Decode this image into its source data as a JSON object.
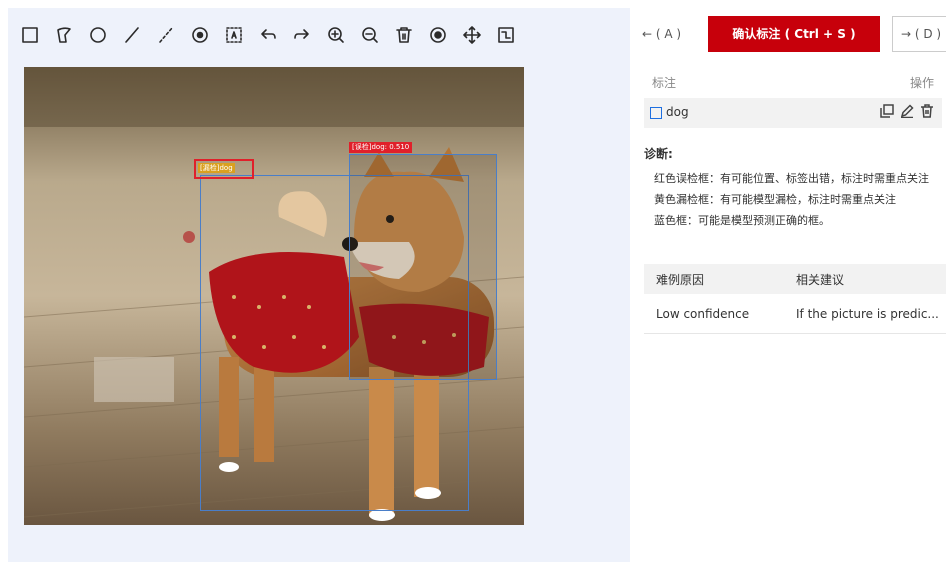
{
  "toolbar": {
    "tools": [
      {
        "icon": "rectangle-icon"
      },
      {
        "icon": "polygon-icon"
      },
      {
        "icon": "circle-icon"
      },
      {
        "icon": "line-icon"
      },
      {
        "icon": "dashed-line-icon"
      },
      {
        "icon": "point-icon"
      },
      {
        "icon": "auto-label-icon"
      },
      {
        "icon": "undo-icon"
      },
      {
        "icon": "redo-icon"
      },
      {
        "icon": "zoom-in-icon"
      },
      {
        "icon": "zoom-out-icon"
      },
      {
        "icon": "delete-icon"
      },
      {
        "icon": "visibility-icon"
      },
      {
        "icon": "move-icon"
      },
      {
        "icon": "fit-screen-icon"
      }
    ]
  },
  "canvas": {
    "pred_tag": "[误检]dog: 0.510",
    "error_tag": "[漏检]dog",
    "box_color": "#4a7ec8",
    "error_color": "#e0202a"
  },
  "nav": {
    "prev": "← ( A )",
    "confirm": "确认标注 ( Ctrl + S )",
    "next": "→ ( D )",
    "accent": "#c7000b"
  },
  "annotations": {
    "col_label": "标注",
    "col_ops": "操作",
    "items": [
      {
        "label": "dog"
      }
    ]
  },
  "diagnosis": {
    "title": "诊断:",
    "lines": [
      "红色误检框：有可能位置、标签出错，标注时需重点关注",
      "黄色漏检框：有可能模型漏检，标注时需重点关注",
      "蓝色框：可能是模型预测正确的框。"
    ]
  },
  "difficult": {
    "col_reason": "难例原因",
    "col_advice": "相关建议",
    "rows": [
      {
        "reason": "Low confidence",
        "advice": "If the picture is predic..."
      }
    ]
  }
}
